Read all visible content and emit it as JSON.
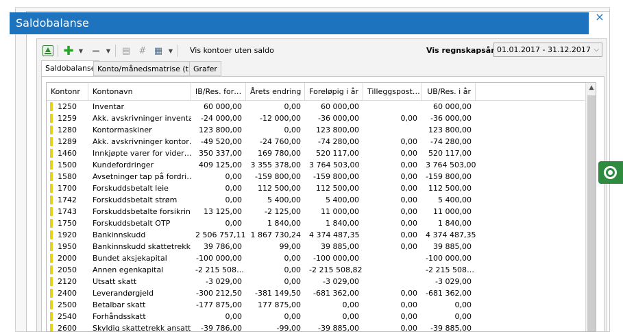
{
  "dialog": {
    "title": "Saldobalanse",
    "close_glyph": "×"
  },
  "toolbar": {
    "show_no_balance_label": "Vis kontoer uten saldo",
    "fiscal_year_label": "Vis regnskapsår:",
    "fiscal_year_value": "01.01.2017 - 31.12.2017",
    "icons": [
      "upload-icon",
      "add-icon",
      "remove-icon",
      "properties-icon",
      "number-icon",
      "calculator-icon"
    ]
  },
  "tabs": [
    {
      "label": "Saldobalanse",
      "active": true
    },
    {
      "label": "Konto/månedsmatrise (tkr)",
      "active": false
    },
    {
      "label": "Grafer",
      "active": false
    }
  ],
  "table": {
    "columns": [
      "Kontonr",
      "Kontonavn",
      "IB/Res. for…",
      "Årets endring",
      "Foreløpig i år",
      "Tilleggspost…",
      "UB/Res. i år"
    ],
    "rows": [
      [
        "1250",
        "Inventar",
        "60 000,00",
        "0,00",
        "60 000,00",
        "",
        "60 000,00"
      ],
      [
        "1259",
        "Akk. avskrivninger inventar",
        "-24 000,00",
        "-12 000,00",
        "-36 000,00",
        "0,00",
        "-36 000,00"
      ],
      [
        "1280",
        "Kontormaskiner",
        "123 800,00",
        "0,00",
        "123 800,00",
        "",
        "123 800,00"
      ],
      [
        "1289",
        "Akk. avskrivninger kontor…",
        "-49 520,00",
        "-24 760,00",
        "-74 280,00",
        "0,00",
        "-74 280,00"
      ],
      [
        "1460",
        "Innkjøpte varer for vider…",
        "350 337,00",
        "169 780,00",
        "520 117,00",
        "0,00",
        "520 117,00"
      ],
      [
        "1500",
        "Kundefordringer",
        "409 125,00",
        "3 355 378,00",
        "3 764 503,00",
        "0,00",
        "3 764 503,00"
      ],
      [
        "1580",
        "Avsetninger tap på fordri…",
        "0,00",
        "-159 800,00",
        "-159 800,00",
        "0,00",
        "-159 800,00"
      ],
      [
        "1700",
        "Forskuddsbetalt leie",
        "0,00",
        "112 500,00",
        "112 500,00",
        "0,00",
        "112 500,00"
      ],
      [
        "1742",
        "Forskuddsbetalt strøm",
        "0,00",
        "5 400,00",
        "5 400,00",
        "0,00",
        "5 400,00"
      ],
      [
        "1743",
        "Forskuddsbetalte forsikrin…",
        "13 125,00",
        "-2 125,00",
        "11 000,00",
        "0,00",
        "11 000,00"
      ],
      [
        "1750",
        "Forskuddsbetalt OTP",
        "0,00",
        "1 840,00",
        "1 840,00",
        "0,00",
        "1 840,00"
      ],
      [
        "1920",
        "Bankinnskudd",
        "2 506 757,11",
        "1 867 730,24",
        "4 374 487,35",
        "0,00",
        "4 374 487,35"
      ],
      [
        "1950",
        "Bankinnskudd skattetrekk",
        "39 786,00",
        "99,00",
        "39 885,00",
        "0,00",
        "39 885,00"
      ],
      [
        "2000",
        "Bundet aksjekapital",
        "-100 000,00",
        "0,00",
        "-100 000,00",
        "",
        "-100 000,00"
      ],
      [
        "2050",
        "Annen egenkapital",
        "-2 215 508…",
        "0,00",
        "-2 215 508,82",
        "",
        "-2 215 508…"
      ],
      [
        "2120",
        "Utsatt skatt",
        "-3 029,00",
        "0,00",
        "-3 029,00",
        "",
        "-3 029,00"
      ],
      [
        "2400",
        "Leverandørgjeld",
        "-300 212,50",
        "-381 149,50",
        "-681 362,00",
        "0,00",
        "-681 362,00"
      ],
      [
        "2500",
        "Betalbar skatt",
        "-177 875,00",
        "177 875,00",
        "0,00",
        "0,00",
        "0,00"
      ],
      [
        "2540",
        "Forhåndsskatt",
        "0,00",
        "0,00",
        "0,00",
        "0,00",
        "0,00"
      ],
      [
        "2600",
        "Skyldig skattetrekk ansatte",
        "-39 786,00",
        "-99,00",
        "-39 885,00",
        "0,00",
        "-39 885,00"
      ]
    ]
  },
  "colors": {
    "titlebar": "#1e73be",
    "row_marker": "#e6d21c",
    "help_button": "#2e8b3f"
  }
}
